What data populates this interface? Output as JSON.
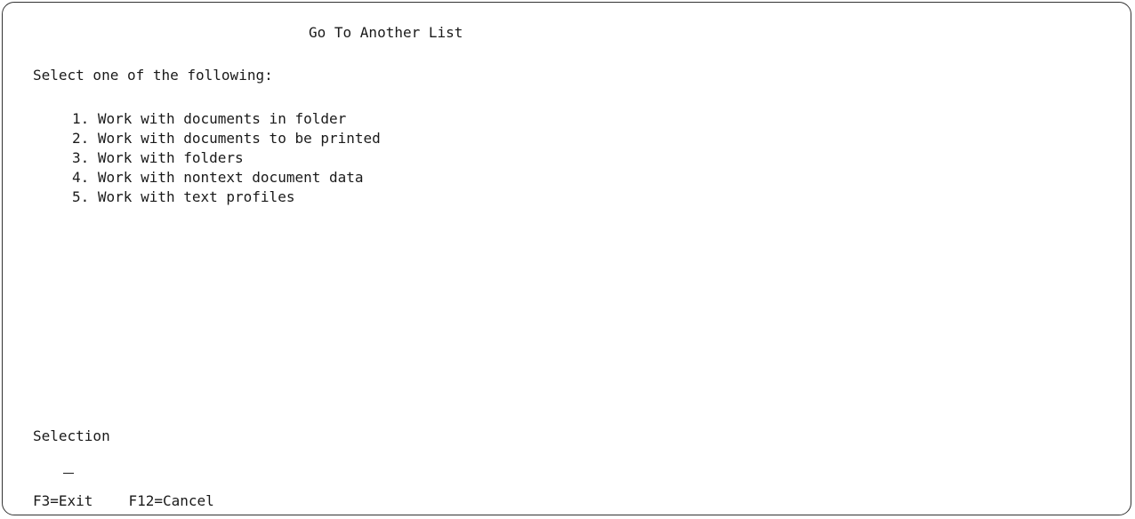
{
  "screen": {
    "title": "Go To Another List",
    "prompt": "Select one of the following:",
    "options": [
      "1. Work with documents in folder",
      "2. Work with documents to be printed",
      "3. Work with folders",
      "4. Work with nontext document data",
      "5. Work with text profiles"
    ],
    "selection_label": "Selection",
    "selection_value": ""
  },
  "function_keys": [
    "F3=Exit",
    "F12=Cancel"
  ]
}
